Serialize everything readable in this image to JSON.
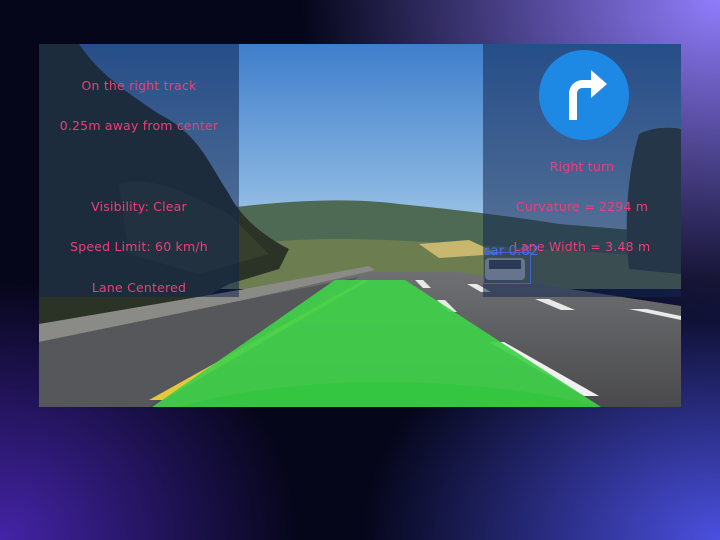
{
  "left_panel": {
    "status": "On the right track",
    "offset": "0.25m away from center",
    "visibility": "Visibility: Clear",
    "speed_limit": "Speed Limit: 60 km/h",
    "lane_status": "Lane Centered"
  },
  "right_panel": {
    "turn_icon": "right-turn-arrow-icon",
    "turn": "Right turn",
    "curvature": "Curvature = 2294 m",
    "lane_width": "Lane Width = 3.48 m"
  },
  "detection": {
    "label": "car 0.82"
  },
  "colors": {
    "hud_text": "#ee3f78",
    "panel": "#122652",
    "lane_fill": "#3fd14a",
    "detection_box": "#3e63d8",
    "turn_icon_bg": "#1e88e5"
  }
}
